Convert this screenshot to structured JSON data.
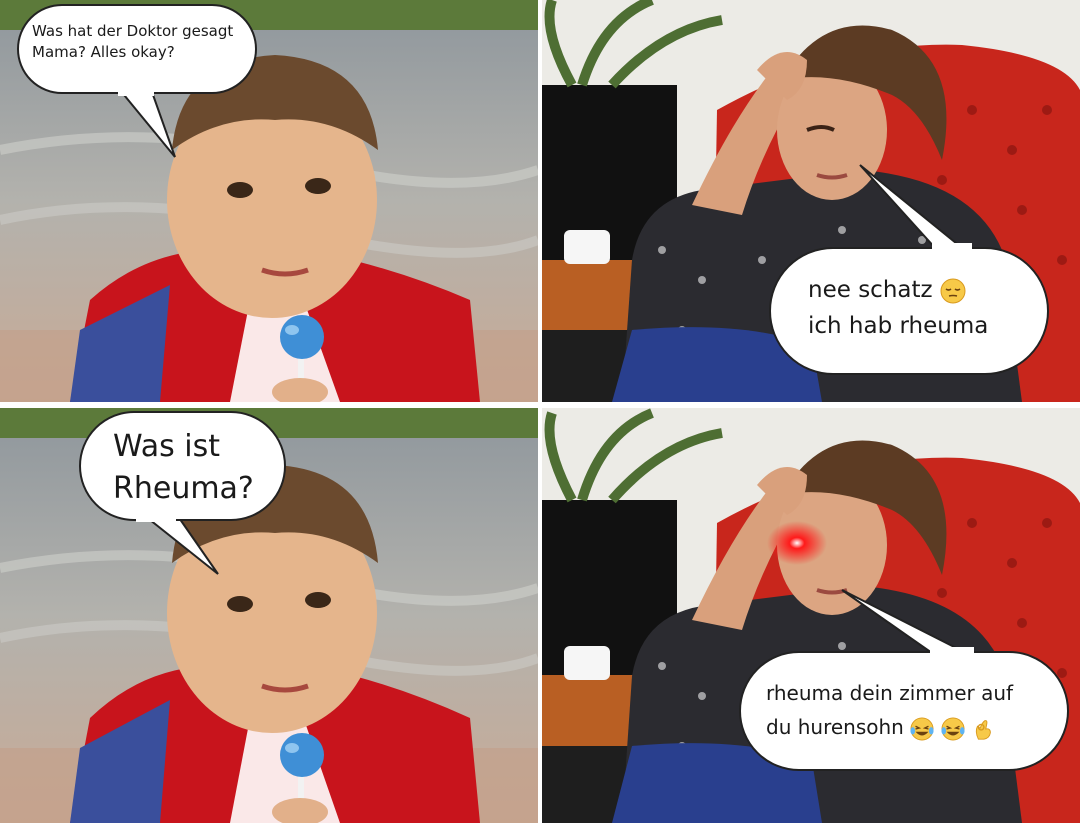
{
  "panels": [
    {
      "id": "boy-question-1",
      "bubble": {
        "lines": [
          "Was hat der Doktor gesagt",
          "Mama? Alles okay?"
        ]
      }
    },
    {
      "id": "mom-answer-1",
      "bubble": {
        "lines": [
          "nee schatz",
          "ich hab rheuma"
        ]
      },
      "emojis": [
        "pensive-face-emoji"
      ]
    },
    {
      "id": "boy-question-2",
      "bubble": {
        "lines": [
          "Was ist",
          "Rheuma?"
        ]
      }
    },
    {
      "id": "mom-answer-2",
      "bubble": {
        "lines": [
          "rheuma dein zimmer auf",
          "du hurensohn"
        ]
      },
      "emojis": [
        "crying-laughing-emoji",
        "crying-laughing-emoji",
        "ok-hand-emoji"
      ]
    }
  ],
  "colors": {
    "jacket_red": "#c8141c",
    "sofa_red": "#c8261c",
    "lollipop_blue": "#3f8fd6",
    "laser_eye": "#ff1a1a"
  }
}
